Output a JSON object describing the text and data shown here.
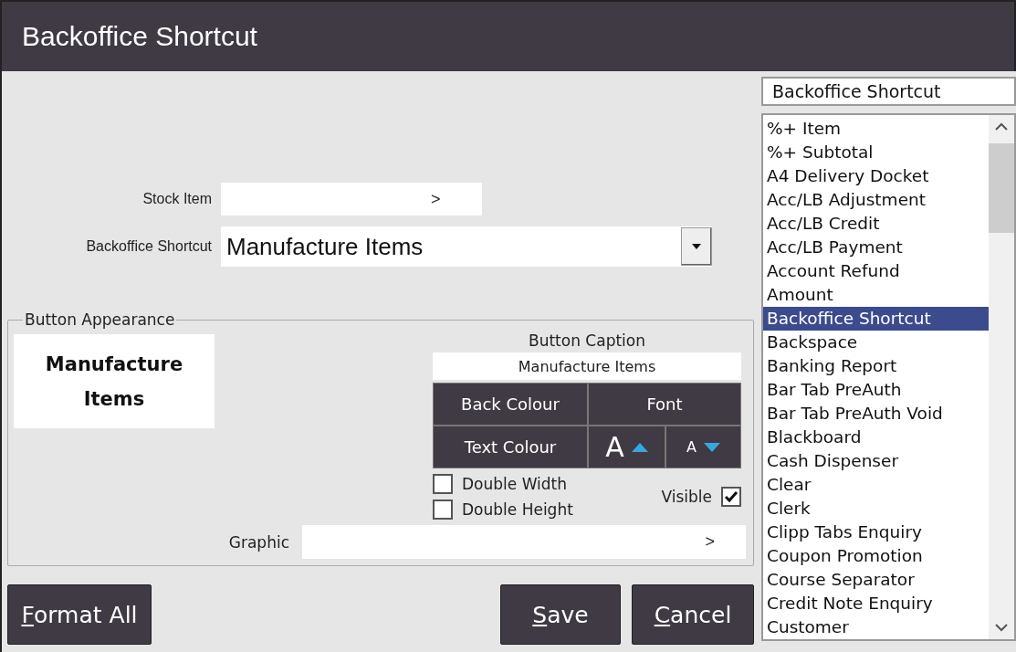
{
  "window": {
    "title": "Backoffice Shortcut"
  },
  "form": {
    "stock_item": {
      "label": "Stock Item",
      "button": ">"
    },
    "backoffice_shortcut": {
      "label": "Backoffice Shortcut",
      "value": "Manufacture Items"
    }
  },
  "button_appearance": {
    "legend": "Button Appearance",
    "preview": "Manufacture Items",
    "caption_heading": "Button Caption",
    "caption": "Manufacture Items",
    "style_buttons": [
      {
        "kind": "text",
        "label": "Back Colour"
      },
      {
        "kind": "text",
        "label": "Font"
      },
      {
        "kind": "text",
        "label": "Text Colour"
      },
      {
        "kind": "grow",
        "label": "A"
      },
      {
        "kind": "shrink",
        "label": "A"
      }
    ],
    "checkboxes": [
      {
        "label": "Double Width",
        "checked": false
      },
      {
        "label": "Double Height",
        "checked": false
      }
    ],
    "visible": {
      "label": "Visible",
      "checked": true
    },
    "graphic": {
      "label": "Graphic",
      "button": ">"
    }
  },
  "buttons": [
    {
      "label": "Format All",
      "access_key_underlined": true
    },
    {
      "label": "Save",
      "access_key_underlined": true
    },
    {
      "label": "Cancel",
      "access_key_underlined": true
    }
  ],
  "function_search": {
    "value": "Backoffice Shortcut"
  },
  "function_list": [
    {
      "label": "%+ Item",
      "selected": false
    },
    {
      "label": "%+ Subtotal",
      "selected": false
    },
    {
      "label": "A4 Delivery Docket",
      "selected": false
    },
    {
      "label": "Acc/LB Adjustment",
      "selected": false
    },
    {
      "label": "Acc/LB Credit",
      "selected": false
    },
    {
      "label": "Acc/LB Payment",
      "selected": false
    },
    {
      "label": "Account Refund",
      "selected": false
    },
    {
      "label": "Amount",
      "selected": false
    },
    {
      "label": "Backoffice Shortcut",
      "selected": true
    },
    {
      "label": "Backspace",
      "selected": false
    },
    {
      "label": "Banking Report",
      "selected": false
    },
    {
      "label": "Bar Tab PreAuth",
      "selected": false
    },
    {
      "label": "Bar Tab PreAuth Void",
      "selected": false
    },
    {
      "label": "Blackboard",
      "selected": false
    },
    {
      "label": "Cash Dispenser",
      "selected": false
    },
    {
      "label": "Clear",
      "selected": false
    },
    {
      "label": "Clerk",
      "selected": false
    },
    {
      "label": "Clipp Tabs Enquiry",
      "selected": false
    },
    {
      "label": "Coupon Promotion",
      "selected": false
    },
    {
      "label": "Course Separator",
      "selected": false
    },
    {
      "label": "Credit Note Enquiry",
      "selected": false
    },
    {
      "label": "Customer",
      "selected": false
    }
  ]
}
